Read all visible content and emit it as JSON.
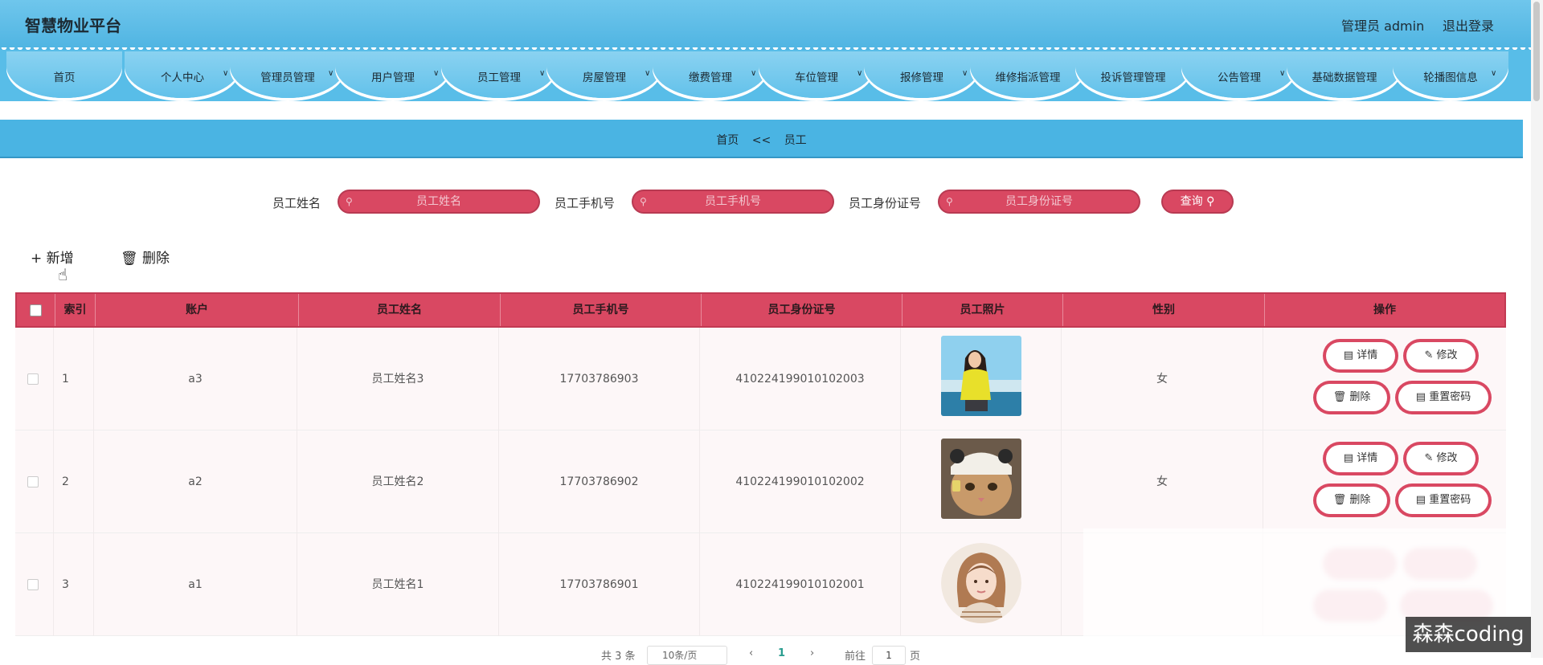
{
  "header": {
    "brand": "智慧物业平台",
    "user": "管理员 admin",
    "logout": "退出登录"
  },
  "nav": [
    {
      "label": "首页",
      "has_dropdown": false
    },
    {
      "label": "个人中心",
      "has_dropdown": true
    },
    {
      "label": "管理员管理",
      "has_dropdown": true
    },
    {
      "label": "用户管理",
      "has_dropdown": true
    },
    {
      "label": "员工管理",
      "has_dropdown": true
    },
    {
      "label": "房屋管理",
      "has_dropdown": true
    },
    {
      "label": "缴费管理",
      "has_dropdown": true
    },
    {
      "label": "车位管理",
      "has_dropdown": true
    },
    {
      "label": "报修管理",
      "has_dropdown": true
    },
    {
      "label": "维修指派管理",
      "has_dropdown": false
    },
    {
      "label": "投诉管理管理",
      "has_dropdown": false
    },
    {
      "label": "公告管理",
      "has_dropdown": true
    },
    {
      "label": "基础数据管理",
      "has_dropdown": false
    },
    {
      "label": "轮播图信息",
      "has_dropdown": true
    }
  ],
  "breadcrumb": {
    "home": "首页",
    "sep": "<<",
    "current": "员工"
  },
  "search": {
    "name_label": "员工姓名",
    "name_placeholder": "员工姓名",
    "phone_label": "员工手机号",
    "phone_placeholder": "员工手机号",
    "id_label": "员工身份证号",
    "id_placeholder": "员工身份证号",
    "button": "查询"
  },
  "toolbar": {
    "add": "新增",
    "delete": "删除"
  },
  "table": {
    "headers": [
      "索引",
      "账户",
      "员工姓名",
      "员工手机号",
      "员工身份证号",
      "员工照片",
      "性别",
      "操作"
    ],
    "rows": [
      {
        "index": "1",
        "account": "a3",
        "name": "员工姓名3",
        "phone": "17703786903",
        "id_no": "410224199010102003",
        "photo": "woman-yellow-sweater-photo",
        "gender": "女"
      },
      {
        "index": "2",
        "account": "a2",
        "name": "员工姓名2",
        "phone": "17703786902",
        "id_no": "410224199010102002",
        "photo": "cat-photo",
        "gender": "女"
      },
      {
        "index": "3",
        "account": "a1",
        "name": "员工姓名1",
        "phone": "17703786901",
        "id_no": "410224199010102001",
        "photo": "illustrated-girl-avatar",
        "gender": ""
      }
    ],
    "actions": {
      "detail": "详情",
      "edit": "修改",
      "delete": "删除",
      "reset": "重置密码"
    }
  },
  "pagination": {
    "total": "共 3 条",
    "page_size": "10条/页",
    "current": "1",
    "goto_label": "前往",
    "goto_value": "1",
    "page_suffix": "页"
  },
  "watermark": "森森coding",
  "colors": {
    "header_blue": "#4fb4e2",
    "accent_red": "#d94862"
  }
}
